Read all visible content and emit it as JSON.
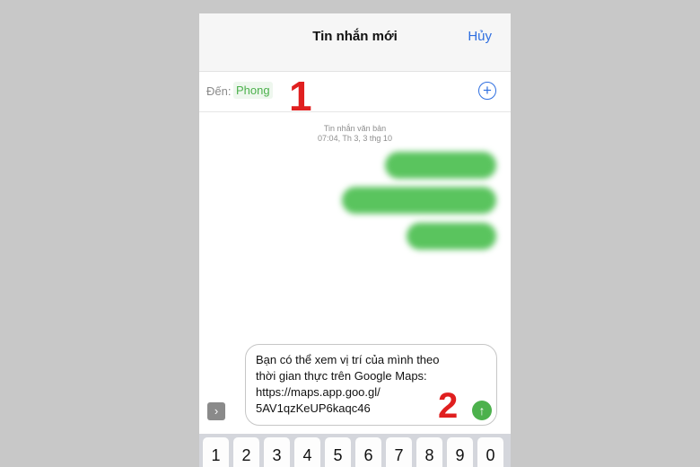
{
  "navbar": {
    "title": "Tin nhắn mới",
    "cancel_label": "Hủy"
  },
  "recipient": {
    "label": "Đến:",
    "name": "Phong",
    "add_icon": "plus-circle-icon"
  },
  "annotations": {
    "one": "1",
    "two": "2"
  },
  "conversation": {
    "timestamp_type": "Tin nhắn văn bản",
    "timestamp_time": "07:04, Th 3, 3 thg 10"
  },
  "compose": {
    "text": "Bạn có thể xem vị trí của mình theo\nthời gian thực trên Google Maps:\nhttps://maps.app.goo.gl/\n5AV1qzKeUP6kaqc46",
    "expand_icon": "chevron-right-icon",
    "send_icon": "arrow-up-icon"
  },
  "keyboard": {
    "keys": [
      "1",
      "2",
      "3",
      "4",
      "5",
      "6",
      "7",
      "8",
      "9",
      "0"
    ]
  },
  "colors": {
    "accent": "#2f6fe0",
    "bubble": "#5ac45e",
    "send": "#4cb14c",
    "annotation": "#e01f1f"
  }
}
